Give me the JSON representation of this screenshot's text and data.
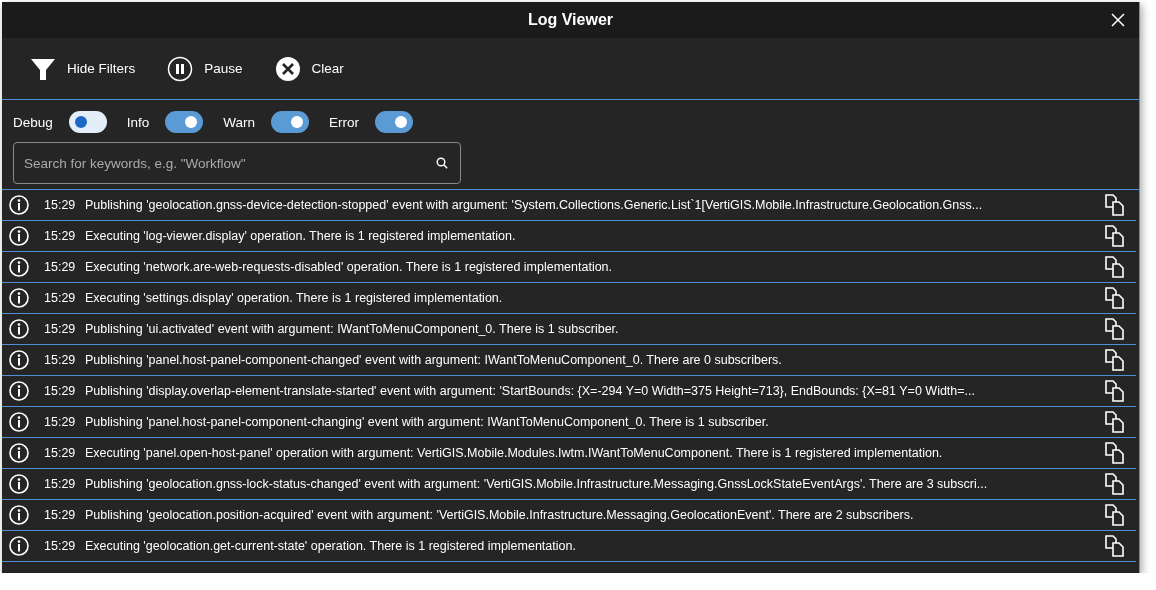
{
  "window": {
    "title": "Log Viewer"
  },
  "toolbar": [
    {
      "kind": "filter",
      "label": "Hide Filters"
    },
    {
      "kind": "pause",
      "label": "Pause"
    },
    {
      "kind": "clear",
      "label": "Clear"
    }
  ],
  "filters": [
    {
      "label": "Debug",
      "on": false
    },
    {
      "label": "Info",
      "on": true
    },
    {
      "label": "Warn",
      "on": true
    },
    {
      "label": "Error",
      "on": true
    }
  ],
  "search": {
    "placeholder": "Search for keywords, e.g. \"Workflow\""
  },
  "log": [
    {
      "kind": "info",
      "time": "15:29",
      "message": "Publishing 'geolocation.gnss-device-detection-stopped' event with argument: 'System.Collections.Generic.List`1[VertiGIS.Mobile.Infrastructure.Geolocation.Gnss..."
    },
    {
      "kind": "info",
      "time": "15:29",
      "message": "Executing 'log-viewer.display' operation. There is 1 registered implementation."
    },
    {
      "kind": "info",
      "time": "15:29",
      "message": "Executing 'network.are-web-requests-disabled' operation. There is 1 registered implementation."
    },
    {
      "kind": "info",
      "time": "15:29",
      "message": "Executing 'settings.display' operation. There is 1 registered implementation."
    },
    {
      "kind": "info",
      "time": "15:29",
      "message": "Publishing 'ui.activated' event with argument: IWantToMenuComponent_0. There is 1 subscriber."
    },
    {
      "kind": "info",
      "time": "15:29",
      "message": "Publishing 'panel.host-panel-component-changed' event with argument: IWantToMenuComponent_0. There are 0 subscribers."
    },
    {
      "kind": "info",
      "time": "15:29",
      "message": "Publishing 'display.overlap-element-translate-started' event with argument: 'StartBounds: {X=-294 Y=0 Width=375 Height=713}, EndBounds: {X=81 Y=0 Width=..."
    },
    {
      "kind": "info",
      "time": "15:29",
      "message": "Publishing 'panel.host-panel-component-changing' event with argument: IWantToMenuComponent_0. There is 1 subscriber."
    },
    {
      "kind": "info",
      "time": "15:29",
      "message": "Executing 'panel.open-host-panel' operation with argument: VertiGIS.Mobile.Modules.Iwtm.IWantToMenuComponent. There is 1 registered implementation."
    },
    {
      "kind": "info",
      "time": "15:29",
      "message": "Publishing 'geolocation.gnss-lock-status-changed' event with argument: 'VertiGIS.Mobile.Infrastructure.Messaging.GnssLockStateEventArgs'. There are 3 subscri..."
    },
    {
      "kind": "info",
      "time": "15:29",
      "message": "Publishing 'geolocation.position-acquired' event with argument: 'VertiGIS.Mobile.Infrastructure.Messaging.GeolocationEvent'. There are 2 subscribers."
    },
    {
      "kind": "info",
      "time": "15:29",
      "message": "Executing 'geolocation.get-current-state' operation. There is 1 registered implementation."
    }
  ]
}
